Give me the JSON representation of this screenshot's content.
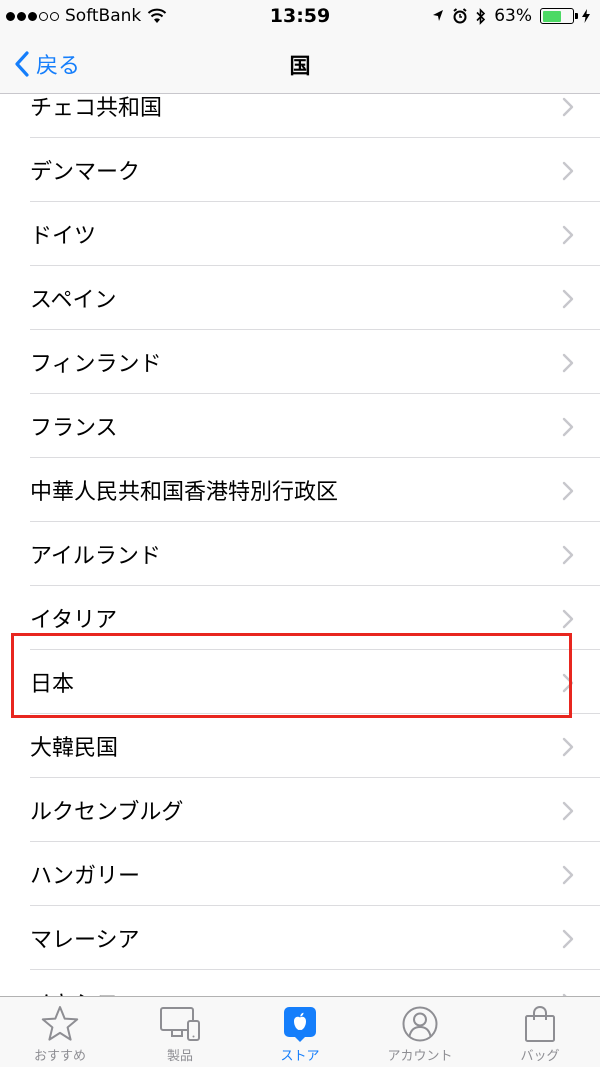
{
  "status_bar": {
    "carrier": "SoftBank",
    "time": "13:59",
    "battery_percent": "63%",
    "battery_level": 0.63,
    "icons": [
      "signal-dots",
      "wifi-icon",
      "location-icon",
      "alarm-icon",
      "bluetooth-icon",
      "battery-icon",
      "charging-bolt-icon"
    ]
  },
  "nav": {
    "back_label": "戻る",
    "title": "国"
  },
  "list": {
    "items": [
      "チェコ共和国",
      "デンマーク",
      "ドイツ",
      "スペイン",
      "フィンランド",
      "フランス",
      "中華人民共和国香港特別行政区",
      "アイルランド",
      "イタリア",
      "日本",
      "大韓民国",
      "ルクセンブルグ",
      "ハンガリー",
      "マレーシア",
      "メキシコ"
    ],
    "highlighted": "日本",
    "highlight_color": "#e8261f"
  },
  "tabs": [
    {
      "label": "おすすめ",
      "icon": "star-icon",
      "active": false
    },
    {
      "label": "製品",
      "icon": "devices-icon",
      "active": false
    },
    {
      "label": "ストア",
      "icon": "apple-store-icon",
      "active": true
    },
    {
      "label": "アカウント",
      "icon": "account-icon",
      "active": false
    },
    {
      "label": "バッグ",
      "icon": "bag-icon",
      "active": false
    }
  ],
  "colors": {
    "accent": "#157efb",
    "inactive": "#8e8e93",
    "battery": "#4cd964"
  }
}
